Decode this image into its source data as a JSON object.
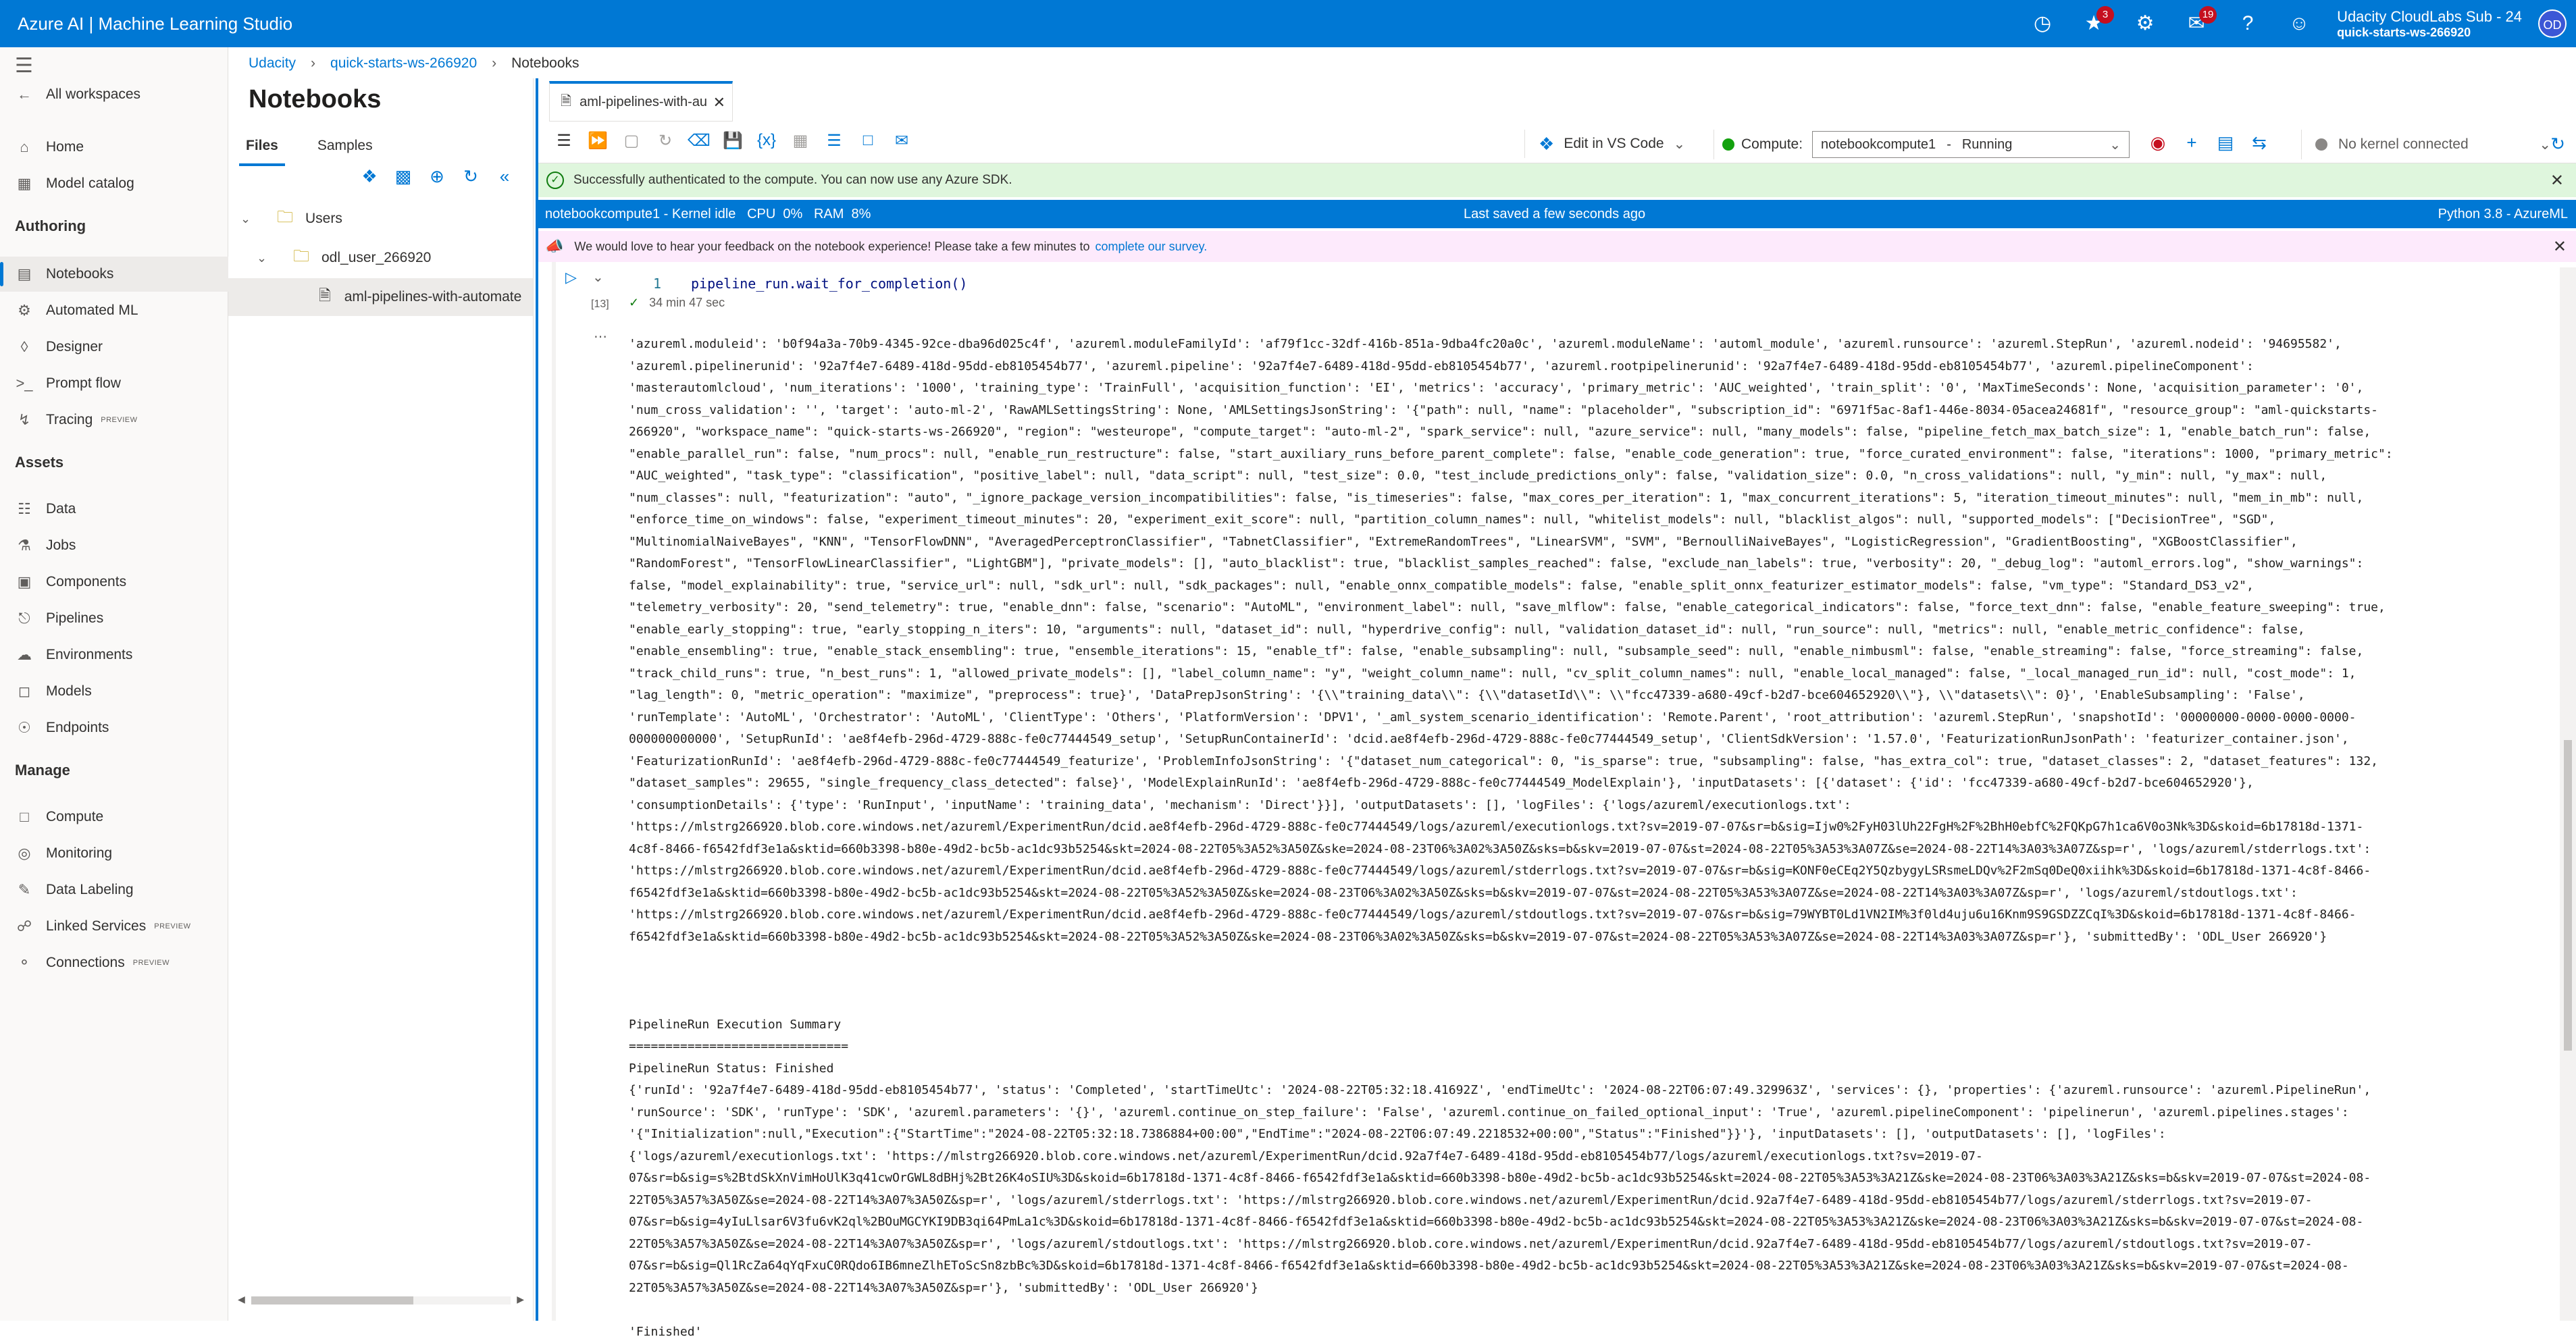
{
  "app": {
    "title": "Azure AI | Machine Learning Studio",
    "notifications_badge": "3",
    "feedback_badge": "19",
    "account_name": "Udacity CloudLabs Sub - 24",
    "account_tenant": "quick-starts-ws-266920",
    "avatar_initials": "OD"
  },
  "nav": {
    "all_workspaces": "All workspaces",
    "home": "Home",
    "model_catalog": "Model catalog",
    "authoring": "Authoring",
    "notebooks": "Notebooks",
    "automated_ml": "Automated ML",
    "designer": "Designer",
    "prompt_flow": "Prompt flow",
    "tracing": "Tracing",
    "preview": "PREVIEW",
    "assets": "Assets",
    "data": "Data",
    "jobs": "Jobs",
    "components": "Components",
    "pipelines": "Pipelines",
    "environments": "Environments",
    "models": "Models",
    "endpoints": "Endpoints",
    "manage": "Manage",
    "compute": "Compute",
    "monitoring": "Monitoring",
    "data_labeling": "Data Labeling",
    "linked_services": "Linked Services",
    "connections": "Connections"
  },
  "breadcrumb": [
    "Udacity",
    "quick-starts-ws-266920",
    "Notebooks"
  ],
  "files": {
    "title": "Notebooks",
    "tab_files": "Files",
    "tab_samples": "Samples",
    "users": "Users",
    "user_folder": "odl_user_266920",
    "notebook": "aml-pipelines-with-automate"
  },
  "editor": {
    "file_tab": "aml-pipelines-with-au",
    "edit_vscode": "Edit in VS Code",
    "compute_label": "Compute:",
    "compute_name": "notebookcompute1",
    "compute_state": "Running",
    "kernel": "No kernel connected",
    "success_msg": "Successfully authenticated to the compute. You can now use any Azure SDK.",
    "status_left": "notebookcompute1 - Kernel idle   CPU  0%   RAM  8%",
    "status_center": "Last saved a few seconds ago",
    "status_right": "Python 3.8 - AzureML",
    "survey_text": "We would love to hear your feedback on the notebook experience! Please take a few minutes to",
    "survey_link": "complete our survey.",
    "exec_count": "[13]",
    "line_no": "1",
    "code": "pipeline_run.wait_for_completion()",
    "elapsed": "34 min 47 sec"
  },
  "output_text": "'azureml.moduleid': 'b0f94a3a-70b9-4345-92ce-dba96d025c4f', 'azureml.moduleFamilyId': 'af79f1cc-32df-416b-851a-9dba4fc20a0c', 'azureml.moduleName': 'automl_module', 'azureml.runsource': 'azureml.StepRun', 'azureml.nodeid': '94695582',\n'azureml.pipelinerunid': '92a7f4e7-6489-418d-95dd-eb8105454b77', 'azureml.pipeline': '92a7f4e7-6489-418d-95dd-eb8105454b77', 'azureml.rootpipelinerunid': '92a7f4e7-6489-418d-95dd-eb8105454b77', 'azureml.pipelineComponent':\n'masterautomlcloud', 'num_iterations': '1000', 'training_type': 'TrainFull', 'acquisition_function': 'EI', 'metrics': 'accuracy', 'primary_metric': 'AUC_weighted', 'train_split': '0', 'MaxTimeSeconds': None, 'acquisition_parameter': '0',\n'num_cross_validation': '', 'target': 'auto-ml-2', 'RawAMLSettingsString': None, 'AMLSettingsJsonString': '{\"path\": null, \"name\": \"placeholder\", \"subscription_id\": \"6971f5ac-8af1-446e-8034-05acea24681f\", \"resource_group\": \"aml-quickstarts-\n266920\", \"workspace_name\": \"quick-starts-ws-266920\", \"region\": \"westeurope\", \"compute_target\": \"auto-ml-2\", \"spark_service\": null, \"azure_service\": null, \"many_models\": false, \"pipeline_fetch_max_batch_size\": 1, \"enable_batch_run\": false,\n\"enable_parallel_run\": false, \"num_procs\": null, \"enable_run_restructure\": false, \"start_auxiliary_runs_before_parent_complete\": false, \"enable_code_generation\": true, \"force_curated_environment\": false, \"iterations\": 1000, \"primary_metric\":\n\"AUC_weighted\", \"task_type\": \"classification\", \"positive_label\": null, \"data_script\": null, \"test_size\": 0.0, \"test_include_predictions_only\": false, \"validation_size\": 0.0, \"n_cross_validations\": null, \"y_min\": null, \"y_max\": null,\n\"num_classes\": null, \"featurization\": \"auto\", \"_ignore_package_version_incompatibilities\": false, \"is_timeseries\": false, \"max_cores_per_iteration\": 1, \"max_concurrent_iterations\": 5, \"iteration_timeout_minutes\": null, \"mem_in_mb\": null,\n\"enforce_time_on_windows\": false, \"experiment_timeout_minutes\": 20, \"experiment_exit_score\": null, \"partition_column_names\": null, \"whitelist_models\": null, \"blacklist_algos\": null, \"supported_models\": [\"DecisionTree\", \"SGD\",\n\"MultinomialNaiveBayes\", \"KNN\", \"TensorFlowDNN\", \"AveragedPerceptronClassifier\", \"TabnetClassifier\", \"ExtremeRandomTrees\", \"LinearSVM\", \"SVM\", \"BernoulliNaiveBayes\", \"LogisticRegression\", \"GradientBoosting\", \"XGBoostClassifier\",\n\"RandomForest\", \"TensorFlowLinearClassifier\", \"LightGBM\"], \"private_models\": [], \"auto_blacklist\": true, \"blacklist_samples_reached\": false, \"exclude_nan_labels\": true, \"verbosity\": 20, \"_debug_log\": \"automl_errors.log\", \"show_warnings\":\nfalse, \"model_explainability\": true, \"service_url\": null, \"sdk_url\": null, \"sdk_packages\": null, \"enable_onnx_compatible_models\": false, \"enable_split_onnx_featurizer_estimator_models\": false, \"vm_type\": \"Standard_DS3_v2\",\n\"telemetry_verbosity\": 20, \"send_telemetry\": true, \"enable_dnn\": false, \"scenario\": \"AutoML\", \"environment_label\": null, \"save_mlflow\": false, \"enable_categorical_indicators\": false, \"force_text_dnn\": false, \"enable_feature_sweeping\": true,\n\"enable_early_stopping\": true, \"early_stopping_n_iters\": 10, \"arguments\": null, \"dataset_id\": null, \"hyperdrive_config\": null, \"validation_dataset_id\": null, \"run_source\": null, \"metrics\": null, \"enable_metric_confidence\": false,\n\"enable_ensembling\": true, \"enable_stack_ensembling\": true, \"ensemble_iterations\": 15, \"enable_tf\": false, \"enable_subsampling\": null, \"subsample_seed\": null, \"enable_nimbusml\": false, \"enable_streaming\": false, \"force_streaming\": false,\n\"track_child_runs\": true, \"n_best_runs\": 1, \"allowed_private_models\": [], \"label_column_name\": \"y\", \"weight_column_name\": null, \"cv_split_column_names\": null, \"enable_local_managed\": false, \"_local_managed_run_id\": null, \"cost_mode\": 1,\n\"lag_length\": 0, \"metric_operation\": \"maximize\", \"preprocess\": true}', 'DataPrepJsonString': '{\\\\\"training_data\\\\\": {\\\\\"datasetId\\\\\": \\\\\"fcc47339-a680-49cf-b2d7-bce604652920\\\\\"}, \\\\\"datasets\\\\\": 0}', 'EnableSubsampling': 'False',\n'runTemplate': 'AutoML', 'Orchestrator': 'AutoML', 'ClientType': 'Others', 'PlatformVersion': 'DPV1', '_aml_system_scenario_identification': 'Remote.Parent', 'root_attribution': 'azureml.StepRun', 'snapshotId': '00000000-0000-0000-0000-\n000000000000', 'SetupRunId': 'ae8f4efb-296d-4729-888c-fe0c77444549_setup', 'SetupRunContainerId': 'dcid.ae8f4efb-296d-4729-888c-fe0c77444549_setup', 'ClientSdkVersion': '1.57.0', 'FeaturizationRunJsonPath': 'featurizer_container.json',\n'FeaturizationRunId': 'ae8f4efb-296d-4729-888c-fe0c77444549_featurize', 'ProblemInfoJsonString': '{\"dataset_num_categorical\": 0, \"is_sparse\": true, \"subsampling\": false, \"has_extra_col\": true, \"dataset_classes\": 2, \"dataset_features\": 132,\n\"dataset_samples\": 29655, \"single_frequency_class_detected\": false}', 'ModelExplainRunId': 'ae8f4efb-296d-4729-888c-fe0c77444549_ModelExplain'}, 'inputDatasets': [{'dataset': {'id': 'fcc47339-a680-49cf-b2d7-bce604652920'},\n'consumptionDetails': {'type': 'RunInput', 'inputName': 'training_data', 'mechanism': 'Direct'}}], 'outputDatasets': [], 'logFiles': {'logs/azureml/executionlogs.txt':\n'https://mlstrg266920.blob.core.windows.net/azureml/ExperimentRun/dcid.ae8f4efb-296d-4729-888c-fe0c77444549/logs/azureml/executionlogs.txt?sv=2019-07-07&sr=b&sig=Ijw0%2FyH03lUh22FgH%2F%2BhH0ebfC%2FQKpG7h1ca6V0o3Nk%3D&skoid=6b17818d-1371-\n4c8f-8466-f6542fdf3e1a&sktid=660b3398-b80e-49d2-bc5b-ac1dc93b5254&skt=2024-08-22T05%3A52%3A50Z&ske=2024-08-23T06%3A02%3A50Z&sks=b&skv=2019-07-07&st=2024-08-22T05%3A53%3A07Z&se=2024-08-22T14%3A03%3A07Z&sp=r', 'logs/azureml/stderrlogs.txt':\n'https://mlstrg266920.blob.core.windows.net/azureml/ExperimentRun/dcid.ae8f4efb-296d-4729-888c-fe0c77444549/logs/azureml/stderrlogs.txt?sv=2019-07-07&sr=b&sig=KONF0eCEq2Y5QzbygyLSRsmeLDQv%2F2mSq0DeQ0xiihk%3D&skoid=6b17818d-1371-4c8f-8466-\nf6542fdf3e1a&sktid=660b3398-b80e-49d2-bc5b-ac1dc93b5254&skt=2024-08-22T05%3A52%3A50Z&ske=2024-08-23T06%3A02%3A50Z&sks=b&skv=2019-07-07&st=2024-08-22T05%3A53%3A07Z&se=2024-08-22T14%3A03%3A07Z&sp=r', 'logs/azureml/stdoutlogs.txt':\n'https://mlstrg266920.blob.core.windows.net/azureml/ExperimentRun/dcid.ae8f4efb-296d-4729-888c-fe0c77444549/logs/azureml/stdoutlogs.txt?sv=2019-07-07&sr=b&sig=79WYBT0Ld1VN2IM%3f0ld4uju6u16Knm9S9GSDZZCqI%3D&skoid=6b17818d-1371-4c8f-8466-\nf6542fdf3e1a&sktid=660b3398-b80e-49d2-bc5b-ac1dc93b5254&skt=2024-08-22T05%3A52%3A50Z&ske=2024-08-23T06%3A02%3A50Z&sks=b&skv=2019-07-07&st=2024-08-22T05%3A53%3A07Z&se=2024-08-22T14%3A03%3A07Z&sp=r'}, 'submittedBy': 'ODL_User 266920'}\n\n\n\nPipelineRun Execution Summary\n==============================\nPipelineRun Status: Finished\n{'runId': '92a7f4e7-6489-418d-95dd-eb8105454b77', 'status': 'Completed', 'startTimeUtc': '2024-08-22T05:32:18.41692Z', 'endTimeUtc': '2024-08-22T06:07:49.329963Z', 'services': {}, 'properties': {'azureml.runsource': 'azureml.PipelineRun',\n'runSource': 'SDK', 'runType': 'SDK', 'azureml.parameters': '{}', 'azureml.continue_on_step_failure': 'False', 'azureml.continue_on_failed_optional_input': 'True', 'azureml.pipelineComponent': 'pipelinerun', 'azureml.pipelines.stages':\n'{\"Initialization\":null,\"Execution\":{\"StartTime\":\"2024-08-22T05:32:18.7386884+00:00\",\"EndTime\":\"2024-08-22T06:07:49.2218532+00:00\",\"Status\":\"Finished\"}}'}, 'inputDatasets': [], 'outputDatasets': [], 'logFiles':\n{'logs/azureml/executionlogs.txt': 'https://mlstrg266920.blob.core.windows.net/azureml/ExperimentRun/dcid.92a7f4e7-6489-418d-95dd-eb8105454b77/logs/azureml/executionlogs.txt?sv=2019-07-\n07&sr=b&sig=s%2BtdSkXnVimHoUlK3q41cwOrGWL8dBHj%2Bt26K4oSIU%3D&skoid=6b17818d-1371-4c8f-8466-f6542fdf3e1a&sktid=660b3398-b80e-49d2-bc5b-ac1dc93b5254&skt=2024-08-22T05%3A53%3A21Z&ske=2024-08-23T06%3A03%3A21Z&sks=b&skv=2019-07-07&st=2024-08-\n22T05%3A57%3A50Z&se=2024-08-22T14%3A07%3A50Z&sp=r', 'logs/azureml/stderrlogs.txt': 'https://mlstrg266920.blob.core.windows.net/azureml/ExperimentRun/dcid.92a7f4e7-6489-418d-95dd-eb8105454b77/logs/azureml/stderrlogs.txt?sv=2019-07-\n07&sr=b&sig=4yIuLlsar6V3fu6vK2ql%2BOuMGCYKI9DB3qi64PmLa1c%3D&skoid=6b17818d-1371-4c8f-8466-f6542fdf3e1a&sktid=660b3398-b80e-49d2-bc5b-ac1dc93b5254&skt=2024-08-22T05%3A53%3A21Z&ske=2024-08-23T06%3A03%3A21Z&sks=b&skv=2019-07-07&st=2024-08-\n22T05%3A57%3A50Z&se=2024-08-22T14%3A07%3A50Z&sp=r', 'logs/azureml/stdoutlogs.txt': 'https://mlstrg266920.blob.core.windows.net/azureml/ExperimentRun/dcid.92a7f4e7-6489-418d-95dd-eb8105454b77/logs/azureml/stdoutlogs.txt?sv=2019-07-\n07&sr=b&sig=Ql1RcZa64qYqFxuC0RQdo6IB6mneZlhEToScSn8zbBc%3D&skoid=6b17818d-1371-4c8f-8466-f6542fdf3e1a&sktid=660b3398-b80e-49d2-bc5b-ac1dc93b5254&skt=2024-08-22T05%3A53%3A21Z&ske=2024-08-23T06%3A03%3A21Z&sks=b&skv=2019-07-07&st=2024-08-\n22T05%3A57%3A50Z&se=2024-08-22T14%3A07%3A50Z&sp=r'}, 'submittedBy': 'ODL_User 266920'}\n\n'Finished'",
  "colors": {
    "accent": "#0078d4",
    "success_bg": "#dff6dd",
    "survey_bg": "#fdeafc"
  },
  "icons": [
    "history-icon",
    "bell-icon",
    "gear-icon",
    "help-icon",
    "feedback-icon",
    "smiley-icon"
  ]
}
